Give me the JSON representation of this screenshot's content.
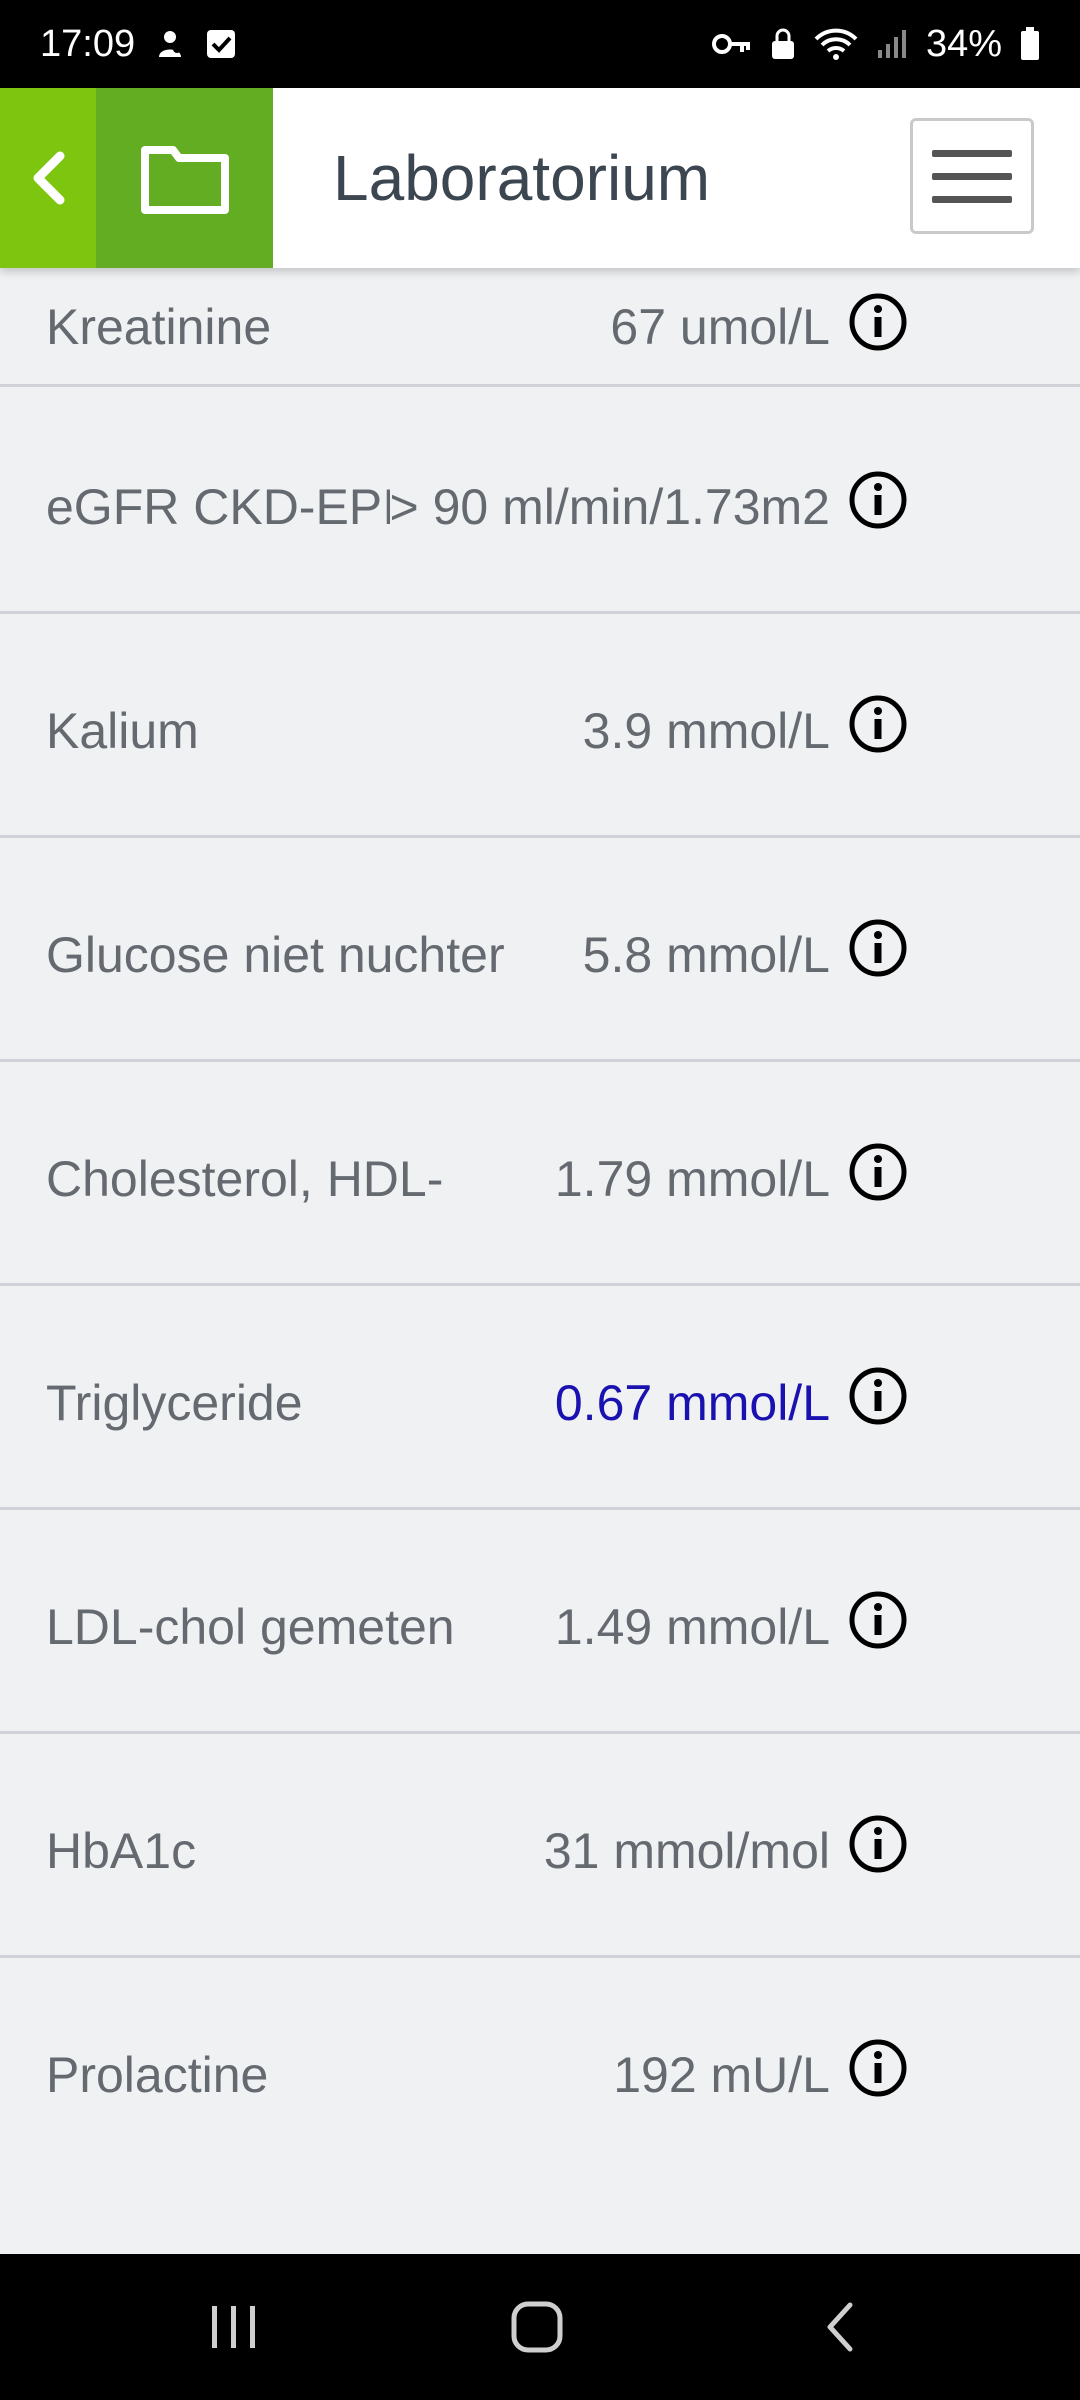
{
  "status_bar": {
    "time": "17:09",
    "battery": "34%",
    "left_icons": [
      "person-notification-icon",
      "checkbox-notification-icon"
    ],
    "right_icons": [
      "key-icon",
      "lock-icon",
      "wifi-icon",
      "signal-icon",
      "battery-icon"
    ]
  },
  "header": {
    "title": "Laboratorium",
    "back_icon": "chevron-left-icon",
    "folder_icon": "folder-icon",
    "menu_icon": "hamburger-menu-icon",
    "colors": {
      "back": "#7dc50f",
      "folder": "#62ad21"
    }
  },
  "lab_results": [
    {
      "name": "Kreatinine",
      "value": "67 umol/L",
      "highlight": false
    },
    {
      "name": "eGFR CKD-EPI",
      "value": "> 90 ml/min/1.73m2",
      "highlight": false
    },
    {
      "name": "Kalium",
      "value": "3.9 mmol/L",
      "highlight": false
    },
    {
      "name": "Glucose niet nuchter",
      "value": "5.8 mmol/L",
      "highlight": false
    },
    {
      "name": "Cholesterol, HDL-",
      "value": "1.79 mmol/L",
      "highlight": false
    },
    {
      "name": "Triglyceride",
      "value": "0.67 mmol/L",
      "highlight": true
    },
    {
      "name": "LDL-chol gemeten",
      "value": "1.49 mmol/L",
      "highlight": false
    },
    {
      "name": "HbA1c",
      "value": "31 mmol/mol",
      "highlight": false
    },
    {
      "name": "Prolactine",
      "value": "192 mU/L",
      "highlight": false
    }
  ],
  "colors": {
    "highlight_value": "#1a12b0",
    "text": "#646a70"
  },
  "nav_bar": {
    "recents_icon": "recent-apps-icon",
    "home_icon": "home-icon",
    "back_icon": "back-icon"
  }
}
